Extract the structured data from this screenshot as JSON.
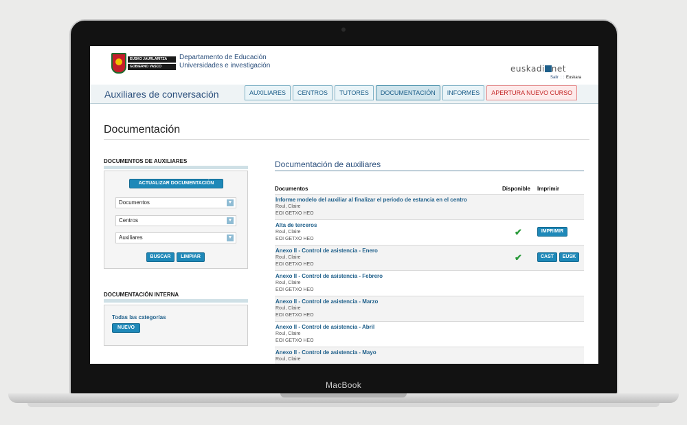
{
  "laptop": {
    "brand": "MacBook"
  },
  "header": {
    "logo_line1": "EUSKO JAURLARITZA",
    "logo_line2": "GOBIERNO VASCO",
    "dept_line1": "Departamento de Educación",
    "dept_line2": "Universidades e investigación",
    "site_brand": "euskadi",
    "site_brand_suffix": "net",
    "link_exit": "Salir",
    "link_sep": ": :",
    "link_lang": "Euskara"
  },
  "app_title": "Auxiliares de conversación",
  "tabs": [
    "AUXILIARES",
    "CENTROS",
    "TUTORES",
    "DOCUMENTACIÓN",
    "INFORMES",
    "APERTURA NUEVO CURSO"
  ],
  "page_title": "Documentación",
  "sidebar": {
    "docs_heading": "DOCUMENTOS DE AUXILIARES",
    "update_button": "ACTUALIZAR DOCUMENTACIÓN",
    "selects": [
      "Documentos",
      "Centros",
      "Auxiliares"
    ],
    "search_button": "BUSCAR",
    "clear_button": "LIMPIAR",
    "internal_heading": "DOCUMENTACIÓN INTERNA",
    "category_link": "Todas las categorías",
    "new_button": "NUEVO"
  },
  "main": {
    "heading": "Documentación de auxiliares",
    "col_docs": "Documentos",
    "col_available": "Disponible",
    "col_print": "Imprimir",
    "print_button": "IMPRIMIR",
    "cast_button": "CAST",
    "eusk_button": "EUSK",
    "rows": [
      {
        "title": "Informe modelo del auxiliar al finalizar el periodo de estancia en el centro",
        "person": "Roul, Claire",
        "centre": "EOI GETXO HEO"
      },
      {
        "title": "Alta de terceros",
        "person": "Roul, Claire",
        "centre": "EOI GETXO HEO"
      },
      {
        "title": "Anexo II - Control de asistencia - Enero",
        "person": "Roul, Claire",
        "centre": "EOI GETXO HEO"
      },
      {
        "title": "Anexo II - Control de asistencia - Febrero",
        "person": "Roul, Claire",
        "centre": "EOI GETXO HEO"
      },
      {
        "title": "Anexo II - Control de asistencia - Marzo",
        "person": "Roul, Claire",
        "centre": "EOI GETXO HEO"
      },
      {
        "title": "Anexo II - Control de asistencia - Abril",
        "person": "Roul, Claire",
        "centre": "EOI GETXO HEO"
      },
      {
        "title": "Anexo II - Control de asistencia - Mayo",
        "person": "Roul, Claire",
        "centre": ""
      }
    ]
  },
  "colors": {
    "accent": "#1e88b8",
    "link": "#1e5f8a",
    "available": "#2a9a3a"
  }
}
